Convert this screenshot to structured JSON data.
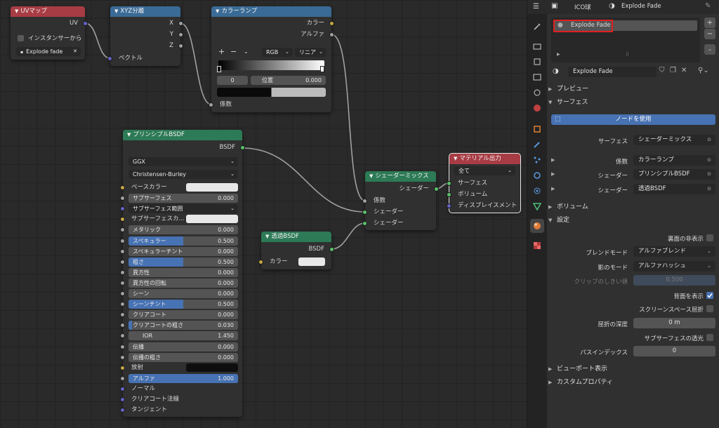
{
  "nodes": {
    "uvmap": {
      "title": "UVマップ",
      "output_uv": "UV",
      "from_instancer_label": "インスタンサーから",
      "uv_map_value": "Explode fade"
    },
    "separate_xyz": {
      "title": "XYZ分離",
      "out_x": "X",
      "out_y": "Y",
      "out_z": "Z",
      "in_vector": "ベクトル"
    },
    "color_ramp": {
      "title": "カラーランプ",
      "out_color": "カラー",
      "out_alpha": "アルファ",
      "add": "+",
      "remove": "−",
      "color_mode": "RGB",
      "interpolation": "リニア",
      "stop_index": "0",
      "position_label": "位置",
      "position_value": "0.000",
      "in_fac": "係数"
    },
    "principled": {
      "title": "プリンシプルBSDF",
      "out_bsdf": "BSDF",
      "distribution": "GGX",
      "subsurface_method": "Christensen-Burley",
      "inputs": [
        {
          "label": "ベースカラー",
          "kind": "color-white",
          "socket": "yellow"
        },
        {
          "label": "サブサーフェス",
          "value": "0.000",
          "fill": 0.0,
          "socket": "gray"
        },
        {
          "label": "サブサーフェス範囲",
          "kind": "dropdown",
          "socket": "purple"
        },
        {
          "label": "サブサーフェスカ...",
          "kind": "color-white",
          "socket": "yellow"
        },
        {
          "label": "メタリック",
          "value": "0.000",
          "fill": 0.0,
          "socket": "gray"
        },
        {
          "label": "スペキュラー",
          "value": "0.500",
          "fill": 0.5,
          "socket": "gray"
        },
        {
          "label": "スペキュラーチント",
          "value": "0.000",
          "fill": 0.0,
          "socket": "gray"
        },
        {
          "label": "粗さ",
          "value": "0.500",
          "fill": 0.5,
          "socket": "gray"
        },
        {
          "label": "異方性",
          "value": "0.000",
          "fill": 0.0,
          "socket": "gray"
        },
        {
          "label": "異方性の回転",
          "value": "0.000",
          "fill": 0.0,
          "socket": "gray"
        },
        {
          "label": "シーン",
          "value": "0.000",
          "fill": 0.0,
          "socket": "gray"
        },
        {
          "label": "シーンチント",
          "value": "0.500",
          "fill": 0.5,
          "socket": "gray"
        },
        {
          "label": "クリアコート",
          "value": "0.000",
          "fill": 0.0,
          "socket": "gray"
        },
        {
          "label": "クリアコートの粗さ",
          "value": "0.030",
          "fill": 0.03,
          "socket": "gray"
        },
        {
          "label": "IOR",
          "value": "1.450",
          "fill": 0.0,
          "socket": "gray",
          "centered": true
        },
        {
          "label": "伝播",
          "value": "0.000",
          "fill": 0.0,
          "socket": "gray"
        },
        {
          "label": "伝播の粗さ",
          "value": "0.000",
          "fill": 0.0,
          "socket": "gray"
        },
        {
          "label": "放射",
          "kind": "color-black",
          "socket": "yellow"
        },
        {
          "label": "アルファ",
          "value": "1.000",
          "fill": 1.0,
          "socket": "gray"
        },
        {
          "label": "ノーマル",
          "kind": "socket-only",
          "socket": "purple"
        },
        {
          "label": "クリアコート法線",
          "kind": "socket-only",
          "socket": "purple"
        },
        {
          "label": "タンジェント",
          "kind": "socket-only",
          "socket": "purple"
        }
      ]
    },
    "transparent": {
      "title": "透過BSDF",
      "out_bsdf": "BSDF",
      "in_color": "カラー"
    },
    "mix_shader": {
      "title": "シェーダーミックス",
      "out_shader": "シェーダー",
      "in_fac": "係数",
      "in_shader_1": "シェーダー",
      "in_shader_2": "シェーダー"
    },
    "material_output": {
      "title": "マテリアル出力",
      "target": "全て",
      "in_surface": "サーフェス",
      "in_volume": "ボリューム",
      "in_displacement": "ディスプレイスメント"
    }
  },
  "properties": {
    "object_name": "ICO球",
    "material_breadcrumb": "Explode Fade",
    "slot_name": "Explode Fade",
    "material_name": "Explode Fade",
    "panels": {
      "preview": "プレビュー",
      "surface": "サーフェス",
      "volume": "ボリューム",
      "settings": "設定",
      "viewport_display": "ビューポート表示",
      "custom_props": "カスタムプロパティ"
    },
    "use_nodes_button": "ノードを使用",
    "surface_rows": [
      {
        "label": "サーフェス",
        "value": "シェーダーミックス"
      },
      {
        "label": "係数",
        "value": "カラーランプ"
      },
      {
        "label": "シェーダー",
        "value": "プリンシプルBSDF"
      },
      {
        "label": "シェーダー",
        "value": "透過BSDF"
      }
    ],
    "settings": {
      "backface_culling": "裏面の非表示",
      "blend_mode_label": "ブレンドモード",
      "blend_mode": "アルファブレンド",
      "shadow_mode_label": "影のモード",
      "shadow_mode": "アルファハッシュ",
      "clip_threshold_label": "クリップのしきい値",
      "clip_threshold": "0.500",
      "show_backface": "背面を表示",
      "screen_space_refraction": "スクリーンスペース屈折",
      "refraction_depth_label": "屈折の深度",
      "refraction_depth": "0 m",
      "subsurface_translucency": "サブサーフェスの透光",
      "pass_index_label": "パスインデックス",
      "pass_index": "0"
    }
  },
  "colors": {
    "node_header_red": "#a83c44",
    "node_header_blue": "#3a6b96",
    "node_header_green": "#2d7a56",
    "accent_blue": "#4772b3",
    "highlight_red": "#e02020"
  }
}
